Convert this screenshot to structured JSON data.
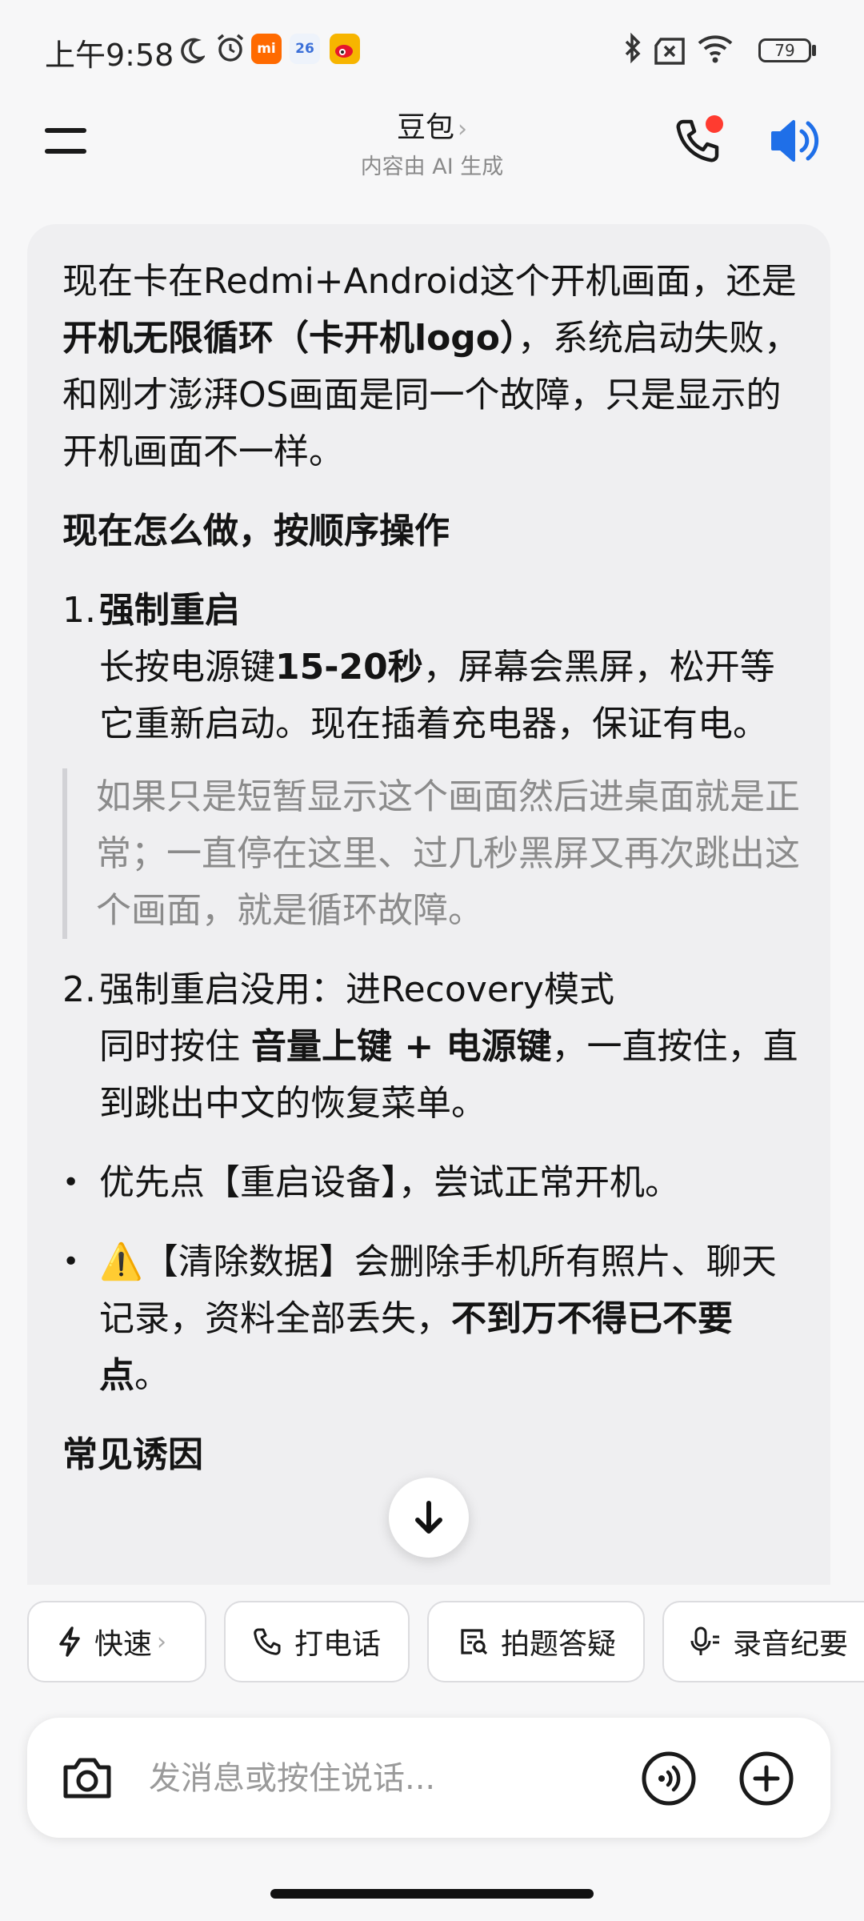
{
  "status_bar": {
    "time": "上午9:58",
    "battery": "79",
    "icons": [
      "moon-icon",
      "alarm-icon",
      "mi-app-icon",
      "calendar-app-icon",
      "weibo-app-icon",
      "bluetooth-icon",
      "no-sim-icon",
      "wifi-icon",
      "battery-icon"
    ],
    "calendar_day": "26",
    "mi_label": "mi"
  },
  "header": {
    "title": "豆包",
    "title_chevron": "›",
    "subtitle": "内容由 AI 生成"
  },
  "message": {
    "intro_1": "现在卡在Redmi+Android这个开机画面，还是",
    "intro_bold": "开机无限循环（卡开机logo）",
    "intro_2": "，系统启动失败，和刚才澎湃OS画面是同一个故障，只是显示的开机画面不一样。",
    "heading_1": "现在怎么做，按顺序操作",
    "step1_num": "1.",
    "step1_title": "强制重启",
    "step1_a": "长按电源键",
    "step1_bold": "15-20秒",
    "step1_b": "，屏幕会黑屏，松开等它重新启动。现在插着充电器，保证有电。",
    "quote": "如果只是短暂显示这个画面然后进桌面就是正常；一直停在这里、过几秒黑屏又再次跳出这个画面，就是循环故障。",
    "step2_num": "2.",
    "step2_title": "强制重启没用：进Recovery模式",
    "step2_a": "同时按住 ",
    "step2_bold": "音量上键 + 电源键",
    "step2_b": "，一直按住，直到跳出中文的恢复菜单。",
    "bullet_symbol": "•",
    "bullet1": "优先点【重启设备】，尝试正常开机。",
    "bullet2_warn": "⚠️",
    "bullet2_a": "【清除数据】会删除手机所有照片、聊天记录，资料全部丢失，",
    "bullet2_bold": "不到万不得已不要点",
    "bullet2_end": "。",
    "heading_2": "常见诱因"
  },
  "chips": {
    "fast": "快速",
    "fast_chevron": "›",
    "call": "打电话",
    "photo_qa": "拍题答疑",
    "record": "录音纪要"
  },
  "input": {
    "placeholder": "发消息或按住说话..."
  },
  "colors": {
    "accent_blue": "#1f6fe8",
    "red_dot": "#ff3b30",
    "mi_orange": "#ff6a00"
  }
}
